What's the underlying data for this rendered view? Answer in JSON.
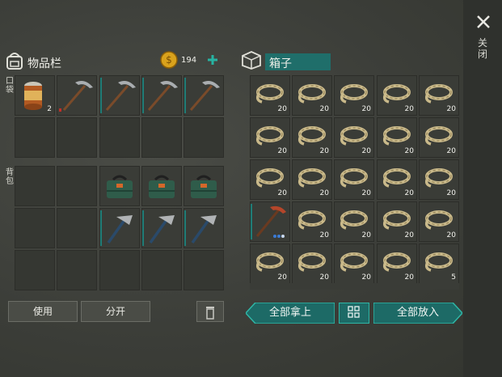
{
  "close_label": "关闭",
  "inventory": {
    "title": "物品栏",
    "coins": "194",
    "pocket_label": "口袋",
    "backpack_label": "背包",
    "items_can_count": "2"
  },
  "box": {
    "title": "箱子",
    "rope_counts": [
      "20",
      "20",
      "20",
      "20",
      "20",
      "20",
      "20",
      "20",
      "20",
      "20",
      "20",
      "20",
      "20",
      "20",
      "20",
      "20",
      "20",
      "20",
      "20",
      "20",
      "20",
      "20",
      "20",
      "5"
    ]
  },
  "buttons": {
    "use": "使用",
    "split": "分开",
    "take_all": "全部拿上",
    "put_all": "全部放入"
  }
}
